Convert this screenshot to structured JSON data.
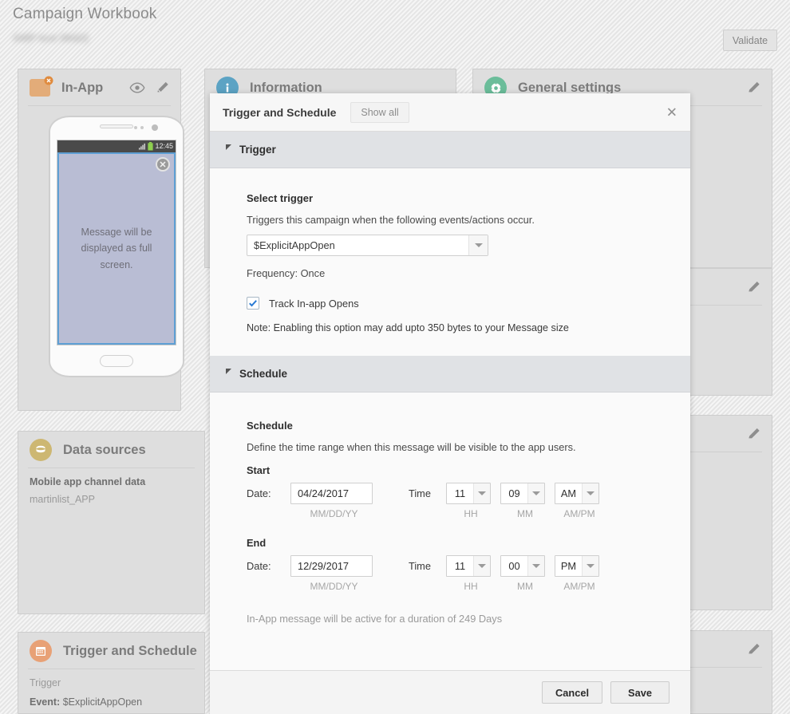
{
  "header": {
    "title": "Campaign Workbook",
    "subtitle": "AMP test 08422",
    "validate_label": "Validate"
  },
  "cards": {
    "in_app": {
      "title": "In-App",
      "icons": [
        "eye-icon",
        "pencil-icon"
      ],
      "preview": {
        "status_time": "12:45",
        "message": "Message will be displayed as full screen."
      }
    },
    "information": {
      "title": "Information",
      "icon": "info-icon",
      "color": "#5ca3c4"
    },
    "general_settings": {
      "title": "General settings",
      "icon": "gear-icon",
      "color": "#6bbd9a"
    },
    "data_sources": {
      "title": "Data sources",
      "icon": "database-icon",
      "color": "#cdb772",
      "line1": "Mobile app channel data",
      "line2": "martinlist_APP"
    },
    "trigger_and_schedule": {
      "title": "Trigger and Schedule",
      "icon": "calendar-icon",
      "color": "#e8a176",
      "sub": "Trigger",
      "kv_key": "Event:",
      "kv_val": "$ExplicitAppOpen"
    }
  },
  "modal": {
    "title": "Trigger and Schedule",
    "show_all_label": "Show all",
    "close_label": "✕",
    "trigger": {
      "section_title": "Trigger",
      "select_label": "Select trigger",
      "select_help": "Triggers this campaign when the following events/actions occur.",
      "select_value": "$ExplicitAppOpen",
      "frequency_label": "Frequency:",
      "frequency_value": "Once",
      "track_label": "Track In-app Opens",
      "track_checked": true,
      "note": "Note: Enabling this option may add upto 350 bytes to your Message size"
    },
    "schedule": {
      "section_title": "Schedule",
      "field_label": "Schedule",
      "field_help": "Define the time range when this message will be visible to the app users.",
      "start": {
        "group_label": "Start",
        "date_label": "Date:",
        "date_value": "04/24/2017",
        "date_hint": "MM/DD/YY",
        "time_label": "Time",
        "hh": "11",
        "mm": "09",
        "ampm": "AM",
        "hh_hint": "HH",
        "mm_hint": "MM",
        "ampm_hint": "AM/PM"
      },
      "end": {
        "group_label": "End",
        "date_label": "Date:",
        "date_value": "12/29/2017",
        "date_hint": "MM/DD/YY",
        "time_label": "Time",
        "hh": "11",
        "mm": "00",
        "ampm": "PM",
        "hh_hint": "HH",
        "mm_hint": "MM",
        "ampm_hint": "AM/PM"
      },
      "duration": "In-App message will be active for a duration of 249 Days"
    },
    "footer": {
      "cancel_label": "Cancel",
      "save_label": "Save"
    }
  }
}
